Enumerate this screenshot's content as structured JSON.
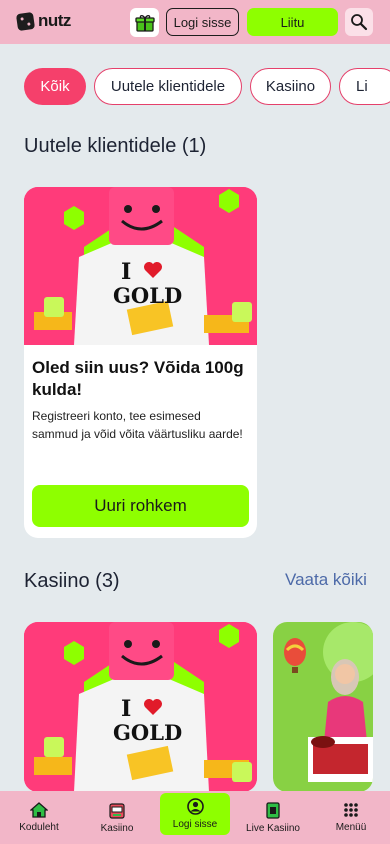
{
  "header": {
    "logo_text": "nutz",
    "login_label": "Logi sisse",
    "join_label": "Liitu",
    "icons": [
      "dice-logo-icon",
      "gift-icon",
      "search-icon"
    ]
  },
  "filters": [
    {
      "label": "Kõik",
      "active": true
    },
    {
      "label": "Uutele klientidele",
      "active": false
    },
    {
      "label": "Kasiino",
      "active": false
    },
    {
      "label": "Li",
      "active": false
    }
  ],
  "sections": {
    "new_clients": {
      "title": "Uutele klientidele (1)"
    },
    "casino": {
      "title": "Kasiino (3)",
      "see_all": "Vaata kõiki"
    }
  },
  "promo_card": {
    "image_shirt_line1": "I",
    "image_shirt_line2": "GOLD",
    "title": "Oled siin uus? Võida 100g kulda!",
    "description": "Registreeri konto, tee esimesed sammud ja võid võita väärtusliku aarde!",
    "cta": "Uuri rohkem"
  },
  "bottom_nav": [
    {
      "label": "Koduleht",
      "icon": "home-icon",
      "active": false
    },
    {
      "label": "Kasiino",
      "icon": "slot-machine-icon",
      "active": false
    },
    {
      "label": "Logi sisse",
      "icon": "user-icon",
      "active": true
    },
    {
      "label": "Live Kasiino",
      "icon": "live-casino-icon",
      "active": false
    },
    {
      "label": "Menüü",
      "icon": "grid-menu-icon",
      "active": false
    }
  ],
  "colors": {
    "header_bg": "#f2b6c8",
    "accent_green": "#8eff00",
    "accent_pink": "#f5406b",
    "page_bg": "#e4eaed",
    "link_blue": "#4d6aa8"
  }
}
